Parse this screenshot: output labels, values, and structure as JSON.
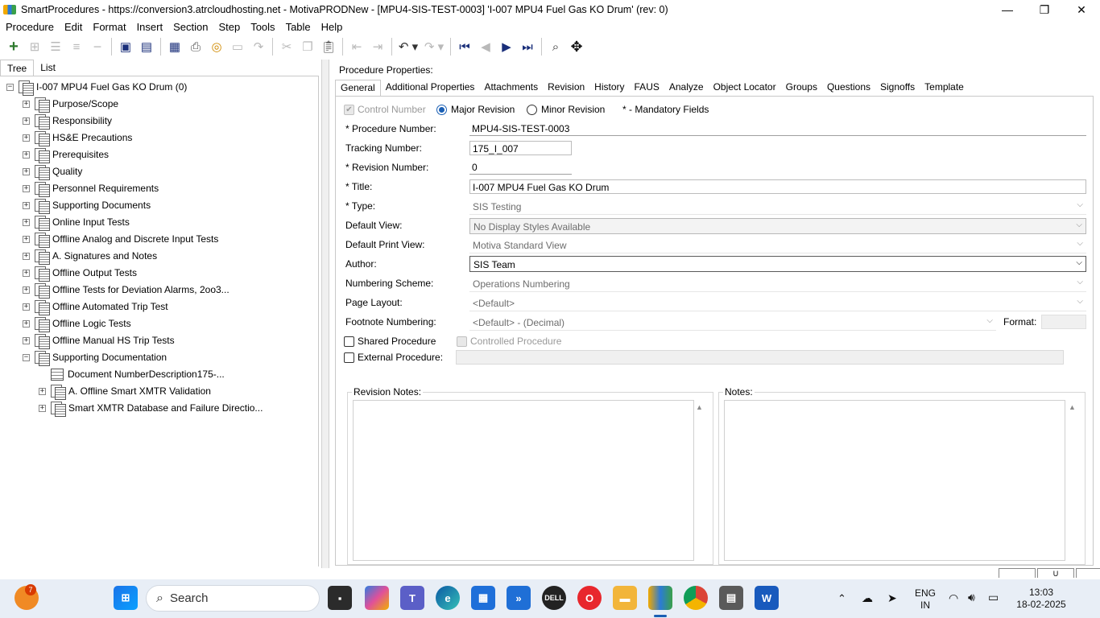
{
  "window": {
    "title": "SmartProcedures - https://conversion3.atrcloudhosting.net - MotivaPRODNew - [MPU4-SIS-TEST-0003] 'I-007 MPU4 Fuel Gas KO Drum' (rev: 0)",
    "minimize": "—",
    "maximize": "❐",
    "close": "✕"
  },
  "menu": [
    "Procedure",
    "Edit",
    "Format",
    "Insert",
    "Section",
    "Step",
    "Tools",
    "Table",
    "Help"
  ],
  "left_tabs": [
    "Tree",
    "List"
  ],
  "tree": {
    "root": "I-007 MPU4 Fuel Gas KO Drum (0)",
    "sections": [
      "Purpose/Scope",
      "Responsibility",
      "HS&E Precautions",
      "Prerequisites",
      "Quality",
      "Personnel Requirements",
      "Supporting Documents",
      "Online Input Tests",
      "Offline Analog and Discrete Input Tests",
      "A. Signatures and Notes",
      "Offline Output Tests",
      "Offline Tests for Deviation Alarms, 2oo3...",
      "Offline Automated Trip Test",
      "Offline Logic Tests",
      "Offline Manual HS Trip Tests",
      "Supporting Documentation"
    ],
    "children": [
      "Document NumberDescription175-...",
      "A. Offline Smart XMTR Validation",
      "Smart XMTR Database and Failure Directio..."
    ]
  },
  "properties": {
    "header": "Procedure Properties:",
    "tabs": [
      "General",
      "Additional Properties",
      "Attachments",
      "Revision",
      "History",
      "FAUS",
      "Analyze",
      "Object Locator",
      "Groups",
      "Questions",
      "Signoffs",
      "Template"
    ],
    "control_number": "Control Number",
    "major_revision": "Major Revision",
    "minor_revision": "Minor Revision",
    "mandatory_note": "* - Mandatory Fields",
    "fields": {
      "procedure_number_label": "* Procedure Number:",
      "procedure_number": "MPU4-SIS-TEST-0003",
      "tracking_number_label": "Tracking Number:",
      "tracking_number": "175_I_007",
      "revision_number_label": "* Revision Number:",
      "revision_number": "0",
      "title_label": "* Title:",
      "title": "I-007 MPU4 Fuel Gas KO Drum",
      "type_label": "* Type:",
      "type": "SIS Testing",
      "default_view_label": "Default View:",
      "default_view": "No Display Styles Available",
      "default_print_view_label": "Default Print View:",
      "default_print_view": "Motiva Standard View",
      "author_label": "Author:",
      "author": "SIS Team",
      "numbering_scheme_label": "Numbering Scheme:",
      "numbering_scheme": "Operations Numbering",
      "page_layout_label": "Page Layout:",
      "page_layout": "<Default>",
      "footnote_numbering_label": "Footnote Numbering:",
      "footnote_numbering": "<Default> - (Decimal)",
      "format_label": "Format:"
    },
    "shared_procedure": "Shared Procedure",
    "controlled_procedure": "Controlled Procedure",
    "external_procedure": "External Procedure:",
    "revision_notes_label": "Revision Notes:",
    "notes_label": "Notes:"
  },
  "statusbar": [
    "",
    "U",
    ""
  ],
  "taskbar": {
    "search_placeholder": "Search",
    "notification_count": "7",
    "language": "ENG",
    "region": "IN",
    "time": "13:03",
    "date": "18-02-2025"
  }
}
